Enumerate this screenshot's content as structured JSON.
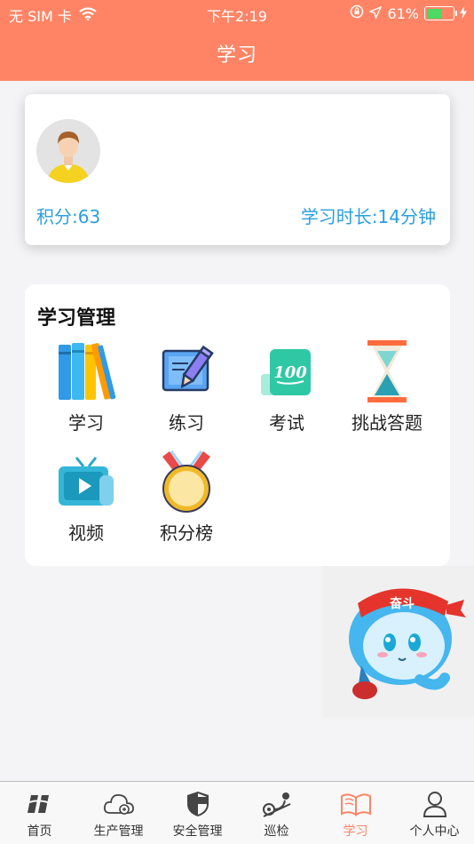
{
  "status_bar": {
    "carrier": "无 SIM 卡",
    "time": "下午2:19",
    "battery": "61%",
    "battery_level": 0.61
  },
  "header": {
    "title": "学习"
  },
  "profile": {
    "score": "积分:63",
    "duration": "学习时长:14分钟"
  },
  "manage": {
    "title": "学习管理",
    "items": [
      {
        "label": "学习",
        "icon": "books-icon"
      },
      {
        "label": "练习",
        "icon": "notebook-pen-icon"
      },
      {
        "label": "考试",
        "icon": "score-100-icon"
      },
      {
        "label": "挑战答题",
        "icon": "hourglass-icon"
      },
      {
        "label": "视频",
        "icon": "tv-play-icon"
      },
      {
        "label": "积分榜",
        "icon": "medal-icon"
      }
    ]
  },
  "mascot": {
    "banner": "奋斗"
  },
  "tabbar": {
    "tabs": [
      {
        "label": "首页",
        "icon": "home-logo-icon"
      },
      {
        "label": "生产管理",
        "icon": "cloud-icon"
      },
      {
        "label": "安全管理",
        "icon": "shield-icon"
      },
      {
        "label": "巡检",
        "icon": "location-route-icon"
      },
      {
        "label": "学习",
        "icon": "open-book-icon",
        "active": true
      },
      {
        "label": "个人中心",
        "icon": "person-icon"
      }
    ]
  },
  "colors": {
    "accent": "#ff8465",
    "link": "#2a9fe0",
    "battery": "#4cd964"
  }
}
